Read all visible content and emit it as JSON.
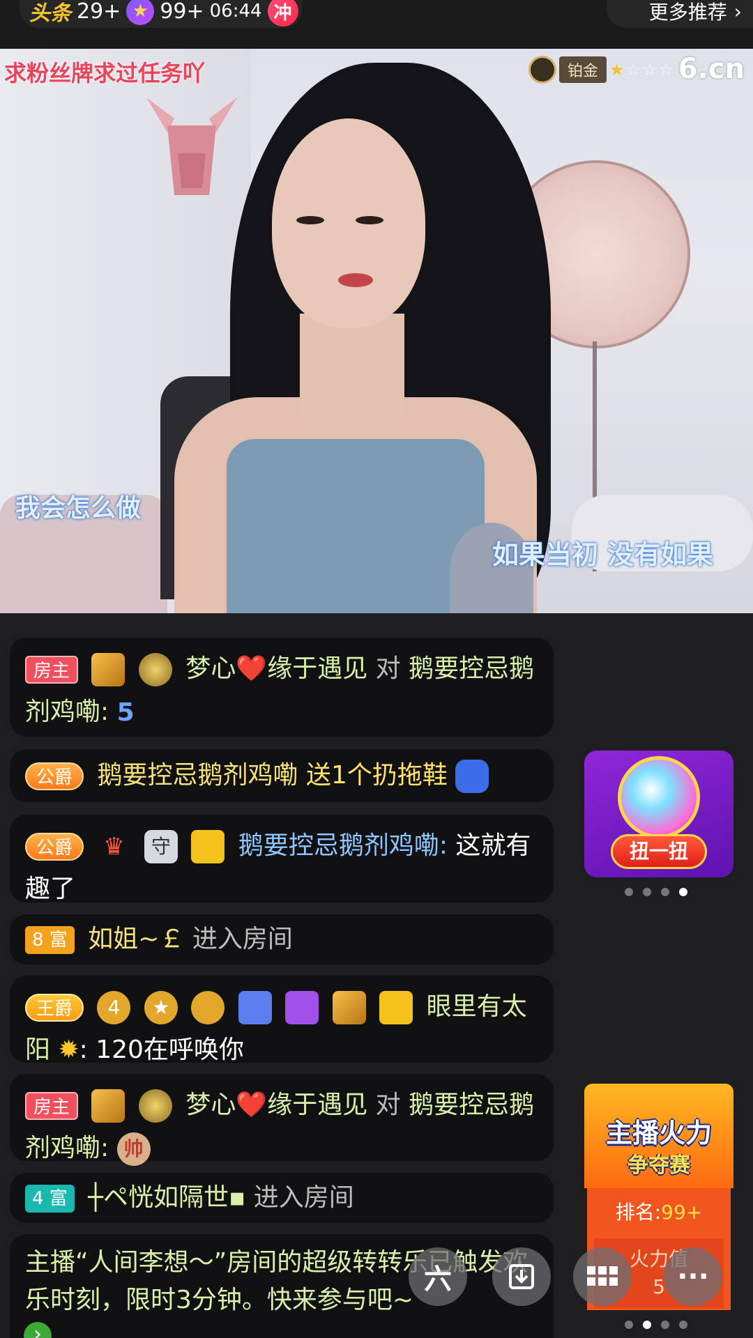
{
  "top": {
    "brand_glyph": "头条",
    "count_left": "29+",
    "count_star": "99+",
    "time": "06:44",
    "chong": "冲",
    "more": "更多推荐"
  },
  "video": {
    "caption_top_left": "求粉丝牌求过任务吖",
    "caption_left": "我会怎么做",
    "caption_right": "如果当初  没有如果",
    "level_label": "铂金",
    "brand": "6.cn"
  },
  "chat": [
    {
      "tag": "房主",
      "name": "梦心❤️缘于遇见",
      "conn": "对",
      "target": "鹅要控忌鹅剂鸡嘞:",
      "badge": "5"
    },
    {
      "tag": "公爵",
      "name": "鹅要控忌鹅剂鸡嘞",
      "gift": "送1个扔拖鞋"
    },
    {
      "tag": "公爵",
      "shield": "守",
      "name": "鹅要控忌鹅剂鸡嘞:",
      "text": "这就有趣了"
    },
    {
      "tag": "8 富",
      "name": "如姐~￡",
      "action": "进入房间"
    },
    {
      "tag": "王爵",
      "name": "眼里有太阳",
      "text": ": 120在呼唤你"
    },
    {
      "tag": "房主",
      "name": "梦心❤️缘于遇见",
      "conn": "对",
      "target": "鹅要控忌鹅剂鸡嘞:",
      "chess": "帅"
    },
    {
      "tag": "4 富",
      "name": "┼ペ恍如隔世▪",
      "action": "进入房间"
    },
    {
      "text": "主播“人间李想～”房间的超级转转乐已触发欢乐时刻，限时3分钟。快来参与吧~"
    }
  ],
  "side": {
    "twist_label": "扭一扭",
    "fire_title": "主播火力",
    "fire_sub": "争夺赛",
    "rank_label": "排名:",
    "rank_value": "99+",
    "fire_value_label": "火力值",
    "fire_value": "5"
  },
  "fabs": {
    "six": "六",
    "more": "···"
  }
}
